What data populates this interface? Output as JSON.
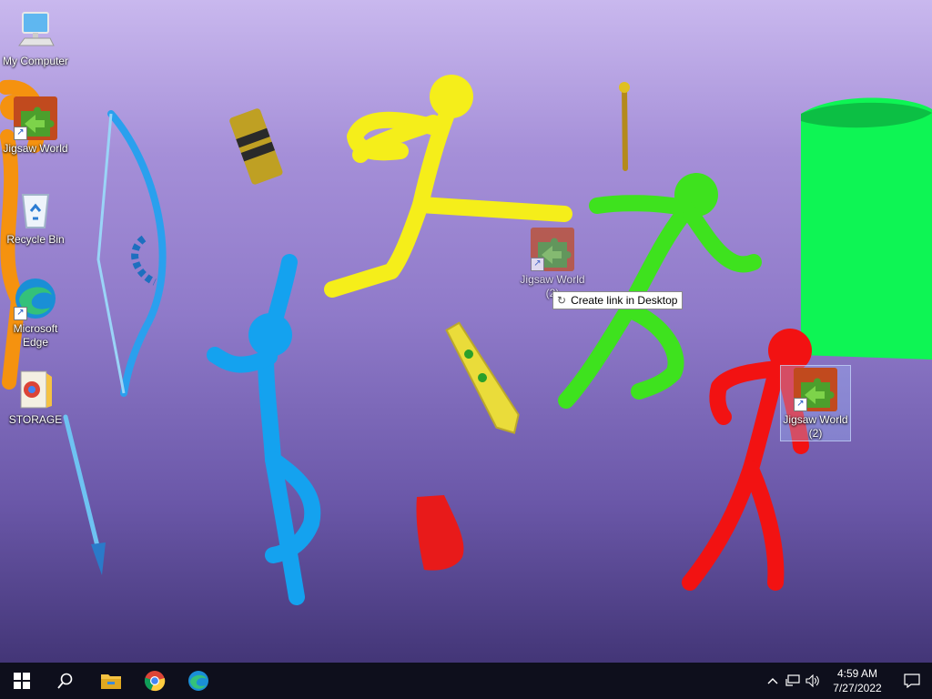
{
  "desktop": {
    "icons": {
      "my_computer": "My Computer",
      "jigsaw_1": "Jigsaw World",
      "recycle_bin": "Recycle Bin",
      "edge": "Microsoft Edge",
      "storage": "STORAGE",
      "jigsaw_drag": "Jigsaw World (2)",
      "jigsaw_2": "Jigsaw World (2)"
    },
    "drag_tooltip": "Create link in Desktop"
  },
  "taskbar": {
    "pinned": [
      "file-explorer-icon",
      "chrome-icon",
      "edge-icon"
    ],
    "clock": {
      "time": "4:59 AM",
      "date": "7/27/2022"
    }
  },
  "colors": {
    "taskbar_bg": "#0e0f1c",
    "yellow_figure": "#f5ee1a",
    "blue_figure": "#14a2ef",
    "green_figure": "#3ee21e",
    "red_figure": "#f21212",
    "orange_figure": "#f5920f"
  }
}
